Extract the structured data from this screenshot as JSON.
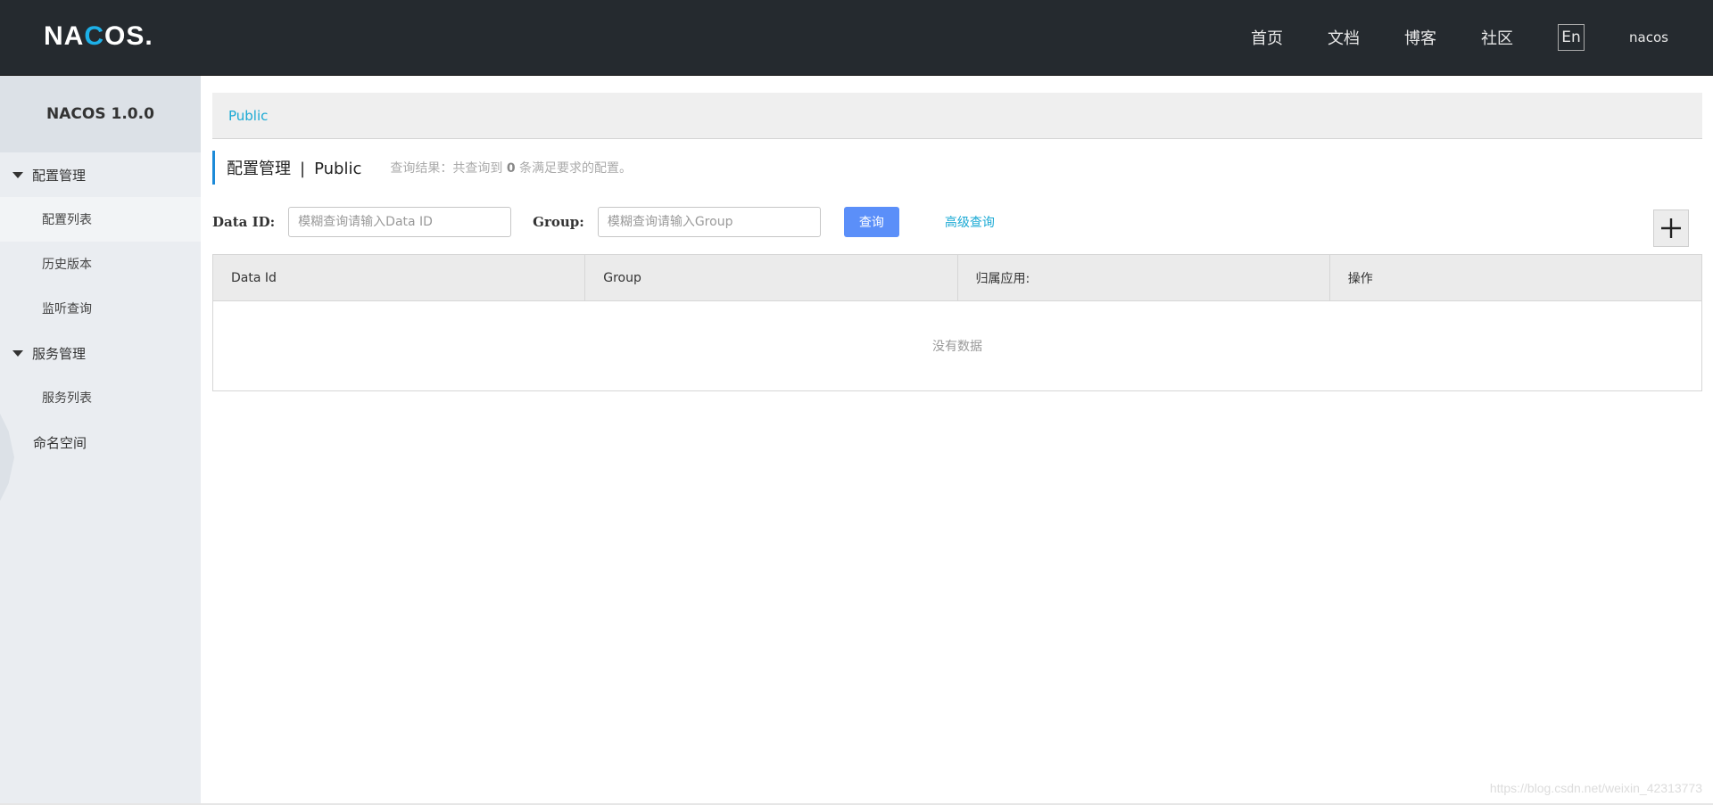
{
  "header": {
    "logo_text_a": "NA",
    "logo_text_c": "C",
    "logo_text_b": "OS.",
    "nav": [
      "首页",
      "文档",
      "博客",
      "社区"
    ],
    "lang": "En",
    "user": "nacos"
  },
  "sidebar": {
    "title": "NACOS 1.0.0",
    "groups": [
      {
        "label": "配置管理",
        "items": [
          "配置列表",
          "历史版本",
          "监听查询"
        ]
      },
      {
        "label": "服务管理",
        "items": [
          "服务列表"
        ]
      }
    ],
    "namespace": "命名空间"
  },
  "main": {
    "breadcrumb": "Public",
    "title": "配置管理",
    "title_sep": "|",
    "title_ns": "Public",
    "query_prefix": "查询结果：共查询到",
    "query_count": "0",
    "query_suffix": "条满足要求的配置。",
    "filters": {
      "data_id_label": "Data ID:",
      "data_id_placeholder": "模糊查询请输入Data ID",
      "group_label": "Group:",
      "group_placeholder": "模糊查询请输入Group",
      "search_button": "查询",
      "advanced_link": "高级查询"
    },
    "table": {
      "columns": [
        "Data Id",
        "Group",
        "归属应用:",
        "操作"
      ],
      "empty_text": "没有数据"
    }
  },
  "watermark": "https://blog.csdn.net/weixin_42313773",
  "colors": {
    "header_bg": "#252a2f",
    "primary_button": "#5b8ff9",
    "link": "#1aa9d4"
  }
}
